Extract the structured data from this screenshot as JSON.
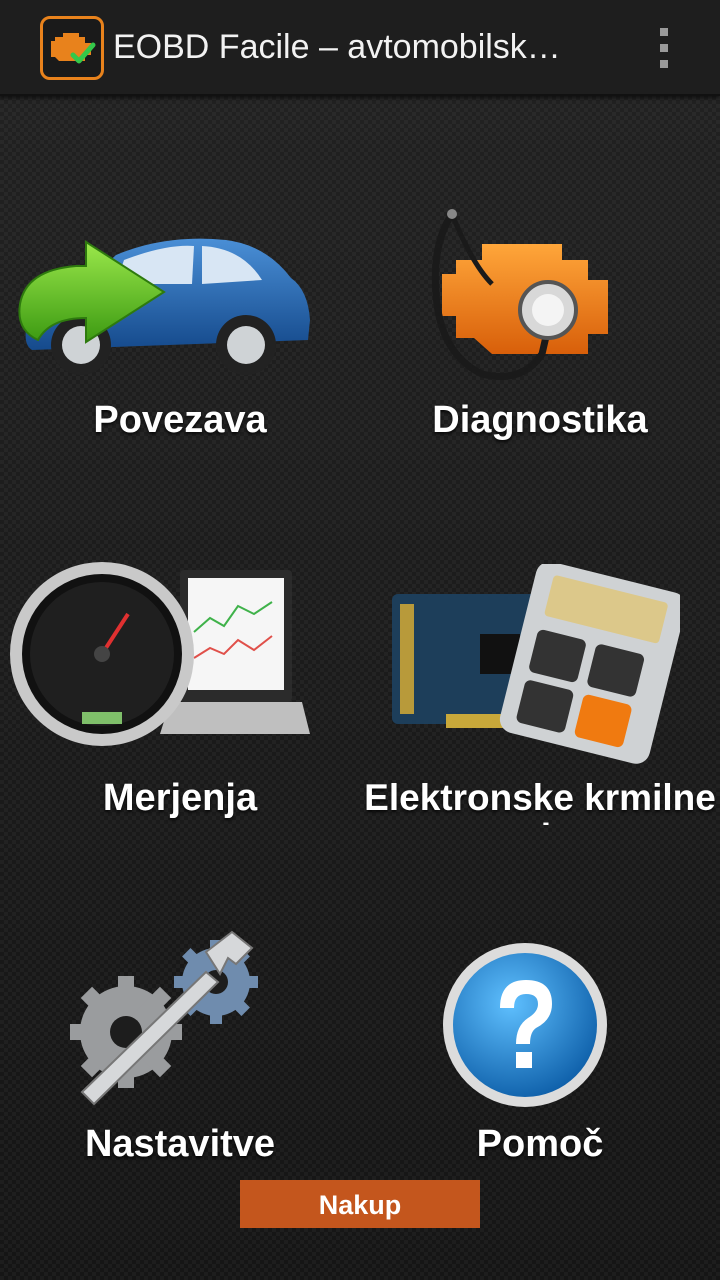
{
  "app": {
    "title": "EOBD Facile – avtomobilsk…"
  },
  "icons": {
    "app": "engine-check-icon",
    "menu": "more-vert-icon"
  },
  "tiles": [
    {
      "label": "Povezava",
      "icon": "car-connect-icon"
    },
    {
      "label": "Diagnostika",
      "icon": "engine-stethoscope-icon"
    },
    {
      "label": "Merjenja",
      "icon": "speedometer-laptop-icon"
    },
    {
      "label": "Elektronske krmilne",
      "icon": "ecu-calculator-icon",
      "label_overflow": "-"
    },
    {
      "label": "Nastavitve",
      "icon": "gears-wrench-icon"
    },
    {
      "label": "Pomoč",
      "icon": "help-question-icon"
    }
  ],
  "buy_button": {
    "label": "Nakup"
  },
  "colors": {
    "accent": "#E8821C",
    "buy_button": "#C4561D",
    "help_blue": "#1E88D8",
    "car_blue": "#1F5FA8",
    "arrow_green": "#5BC41B"
  }
}
